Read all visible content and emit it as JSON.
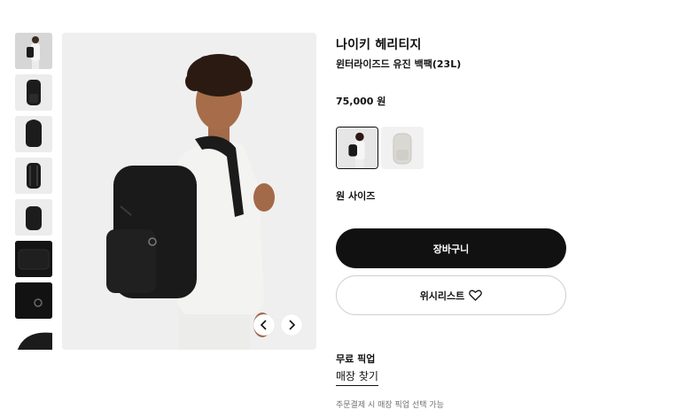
{
  "product": {
    "brand": "나이키 헤리티지",
    "name": "윈터라이즈드 유진 백팩(23L)",
    "price": "75,000 원"
  },
  "gallery": {
    "thumbnails": [
      {
        "icon": "model-with-backpack-thumbnail",
        "tone": "light"
      },
      {
        "icon": "backpack-front-thumbnail",
        "tone": "light"
      },
      {
        "icon": "backpack-angle-thumbnail",
        "tone": "light"
      },
      {
        "icon": "backpack-back-thumbnail",
        "tone": "light"
      },
      {
        "icon": "backpack-side-thumbnail",
        "tone": "light"
      },
      {
        "icon": "pocket-detail-thumbnail",
        "tone": "dark"
      },
      {
        "icon": "zipper-detail-thumbnail",
        "tone": "dark"
      },
      {
        "icon": "top-detail-thumbnail",
        "tone": "dark"
      }
    ],
    "prev_icon": "chevron-left-icon",
    "next_icon": "chevron-right-icon"
  },
  "colors": [
    {
      "name": "black",
      "swatch": "#1a1a1a",
      "selected": true
    },
    {
      "name": "light-bone",
      "swatch": "#d9d8d2",
      "selected": false
    }
  ],
  "size": {
    "label": "원 사이즈"
  },
  "actions": {
    "cart_label": "장바구니",
    "wishlist_label": "위시리스트",
    "wishlist_icon": "heart-outline-icon"
  },
  "pickup": {
    "title": "무료 픽업",
    "store_link": "매장 찾기",
    "note": "주문결제 시 매장 픽업 선택 가능"
  },
  "theme": {
    "primary": "#111111",
    "background": "#ffffff",
    "image_bg": "#efefef",
    "muted_text": "#707072"
  }
}
